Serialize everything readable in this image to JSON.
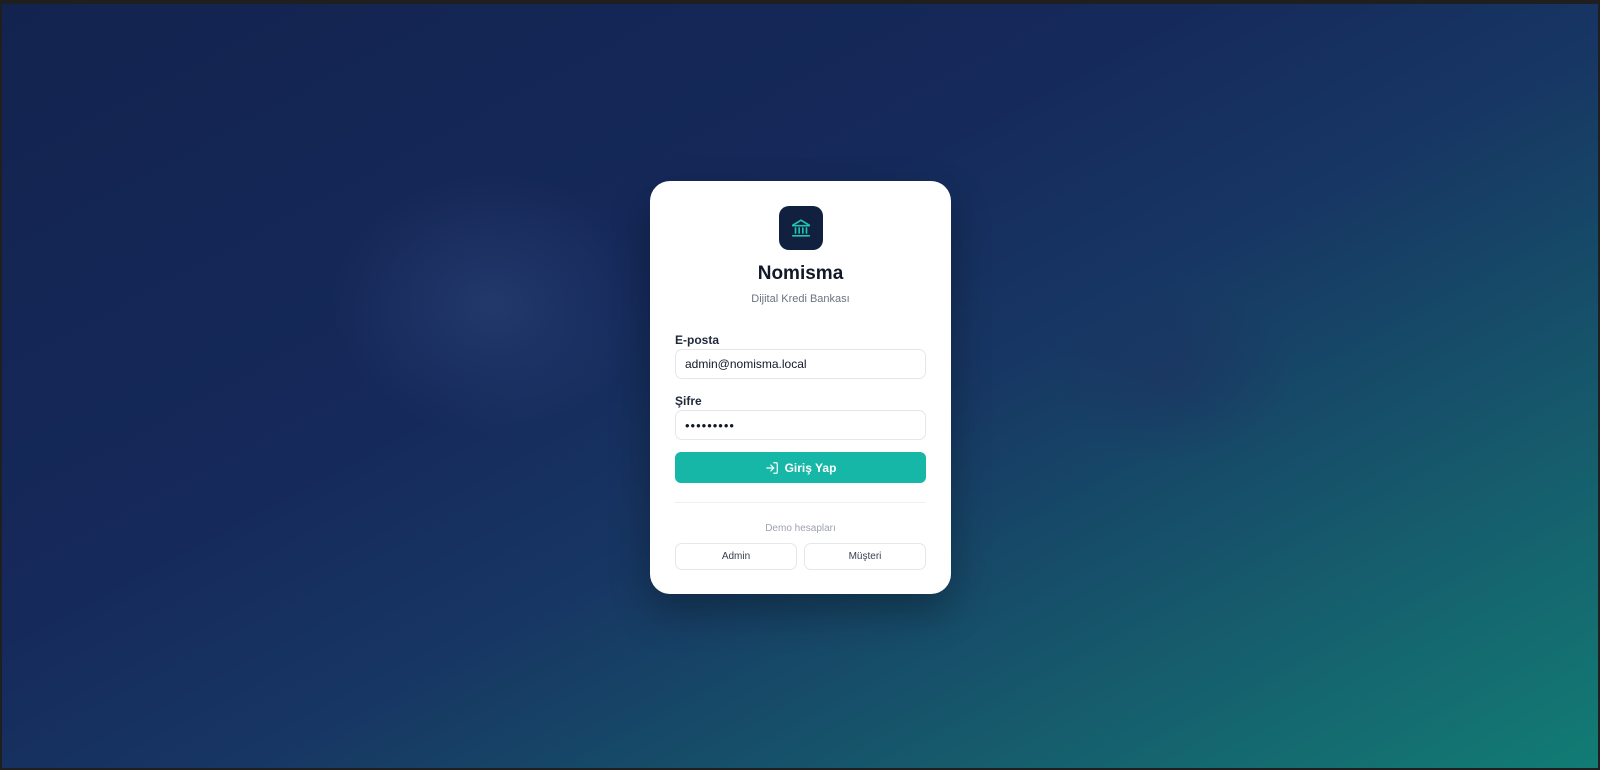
{
  "app": {
    "name": "Nomisma",
    "subtitle": "Dijital Kredi Bankası",
    "logo_icon": "bank-building-icon"
  },
  "colors": {
    "accent": "#16b7a6",
    "logo_bg": "#12203f",
    "logo_fg": "#1fc3b2"
  },
  "form": {
    "email": {
      "label": "E-posta",
      "value": "admin@nomisma.local"
    },
    "password": {
      "label": "Şifre",
      "value": "•••••••••"
    },
    "submit": {
      "label": "Giriş Yap",
      "icon": "login-arrow-icon"
    }
  },
  "demo": {
    "label": "Demo hesapları",
    "accounts": [
      "Admin",
      "Müşteri"
    ]
  }
}
